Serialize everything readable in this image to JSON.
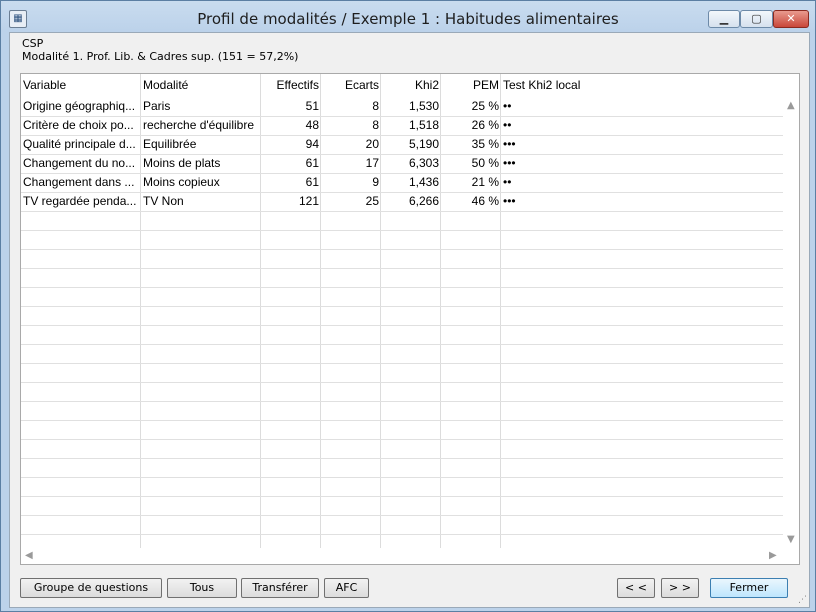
{
  "window": {
    "title": "Profil de modalités / Exemple 1 : Habitudes alimentaires",
    "min_label": "▁",
    "max_label": "▢",
    "close_label": "✕"
  },
  "header": {
    "variable": "CSP",
    "modality_line": "Modalité 1. Prof. Lib. & Cadres sup. (151 = 57,2%)"
  },
  "table": {
    "columns": [
      "Variable",
      "Modalité",
      "Effectifs",
      "Ecarts",
      "Khi2",
      "PEM",
      "Test Khi2 local"
    ],
    "rows": [
      [
        "Origine géographiq...",
        "Paris",
        "51",
        "8",
        "1,530",
        "25 %",
        "••"
      ],
      [
        "Critère de choix po...",
        "recherche d'équilibre",
        "48",
        "8",
        "1,518",
        "26 %",
        "••"
      ],
      [
        "Qualité principale d...",
        "Equilibrée",
        "94",
        "20",
        "5,190",
        "35 %",
        "•••"
      ],
      [
        "Changement du no...",
        "Moins de plats",
        "61",
        "17",
        "6,303",
        "50 %",
        "•••"
      ],
      [
        "Changement dans ...",
        "Moins copieux",
        "61",
        "9",
        "1,436",
        "21 %",
        "••"
      ],
      [
        "TV regardée penda...",
        "TV Non",
        "121",
        "25",
        "6,266",
        "46 %",
        "•••"
      ]
    ]
  },
  "buttons": {
    "groupe": "Groupe de questions",
    "tous": "Tous",
    "transferer": "Transférer",
    "afc": "AFC",
    "prev": "< <",
    "next": "> >",
    "fermer": "Fermer"
  },
  "colors": {
    "accent": "#3c7fb1",
    "close": "#c9473a"
  }
}
